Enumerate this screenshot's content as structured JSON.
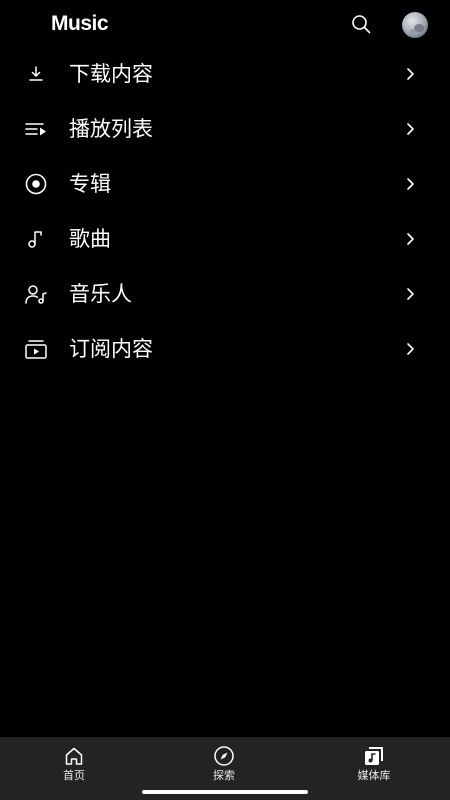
{
  "header": {
    "app_name": "Music",
    "logo_icon": "apple-logo-icon",
    "search_icon": "search-icon",
    "avatar_icon": "profile-avatar"
  },
  "library": {
    "items": [
      {
        "label": "下载内容",
        "icon": "download-icon"
      },
      {
        "label": "播放列表",
        "icon": "playlist-icon"
      },
      {
        "label": "专辑",
        "icon": "album-icon"
      },
      {
        "label": "歌曲",
        "icon": "music-note-icon"
      },
      {
        "label": "音乐人",
        "icon": "artist-icon"
      },
      {
        "label": "订阅内容",
        "icon": "subscription-icon"
      }
    ],
    "chevron_icon": "chevron-right-icon"
  },
  "tabbar": {
    "tabs": [
      {
        "label": "首页",
        "icon": "home-icon",
        "selected": false
      },
      {
        "label": "探索",
        "icon": "compass-icon",
        "selected": false
      },
      {
        "label": "媒体库",
        "icon": "library-icon",
        "selected": true
      }
    ]
  },
  "colors": {
    "background": "#000000",
    "text": "#ffffff",
    "tabbar_background": "#232323"
  }
}
